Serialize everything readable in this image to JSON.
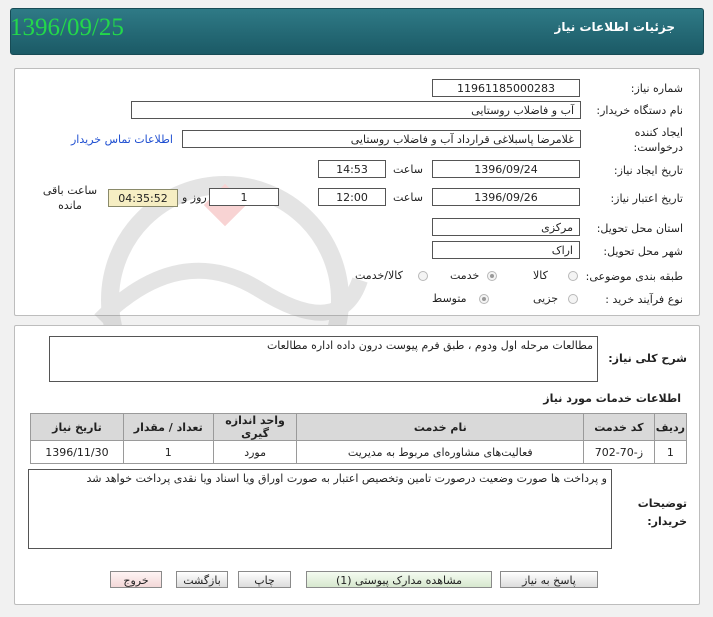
{
  "header": {
    "title": "جزئیات اطلاعات نیاز",
    "date": "1396/09/25"
  },
  "form": {
    "need_number_label": "شماره نیاز:",
    "need_number": "11961185000283",
    "buyer_org_label": "نام دستگاه خریدار:",
    "buyer_org": "آب و فاضلاب روستایی",
    "requester_label": "ایجاد کننده درخواست:",
    "requester": "غلامرضا پاسبلاغی  قرارداد  آب و فاضلاب  روستایی",
    "contact_link": "اطلاعات تماس خریدار",
    "created_label": "تاریخ ایجاد نیاز:",
    "created_date": "1396/09/24",
    "time_label": "ساعت",
    "created_time": "14:53",
    "validity_label": "تاریخ اعتبار نیاز:",
    "validity_date": "1396/09/26",
    "validity_time": "12:00",
    "days_value": "1",
    "days_label": "روز و",
    "remaining_time": "04:35:52",
    "remaining_label": "ساعت باقی مانده",
    "province_label": "استان محل تحویل:",
    "province": "مرکزی",
    "city_label": "شهر محل تحویل:",
    "city": "اراک",
    "category_label": "طبقه بندی موضوعی:",
    "cat_goods": "کالا",
    "cat_service": "خدمت",
    "cat_both": "کالا/خدمت",
    "process_label": "نوع فرآیند خرید :",
    "proc_partial": "جزیی",
    "proc_medium": "متوسط"
  },
  "description": {
    "label": "شرح کلی نیاز:",
    "text": "مطالعات مرحله اول ودوم  ،  طبق فرم پیوست درون داده  اداره مطالعات"
  },
  "services": {
    "title": "اطلاعات خدمات مورد نیاز",
    "columns": [
      "ردیف",
      "کد خدمت",
      "نام خدمت",
      "واحد اندازه گیری",
      "تعداد / مقدار",
      "تاریخ نیاز"
    ],
    "rows": [
      [
        "1",
        "ز-70-702",
        "فعالیت‌های مشاوره‌ای مربوط به مدیریت",
        "مورد",
        "1",
        "1396/11/30"
      ]
    ]
  },
  "buyer_notes": {
    "label": "توضیحات خریدار:",
    "text": "و پرداخت ها صورت وضعیت درصورت تامین وتخصیص اعتبار به صورت اوراق ویا اسناد ویا نقدی پرداخت خواهد شد"
  },
  "buttons": {
    "reply": "پاسخ به نیاز",
    "attachments": "مشاهده مدارک پیوستی (1)",
    "print": "چاپ",
    "back": "بازگشت",
    "exit": "خروج"
  }
}
